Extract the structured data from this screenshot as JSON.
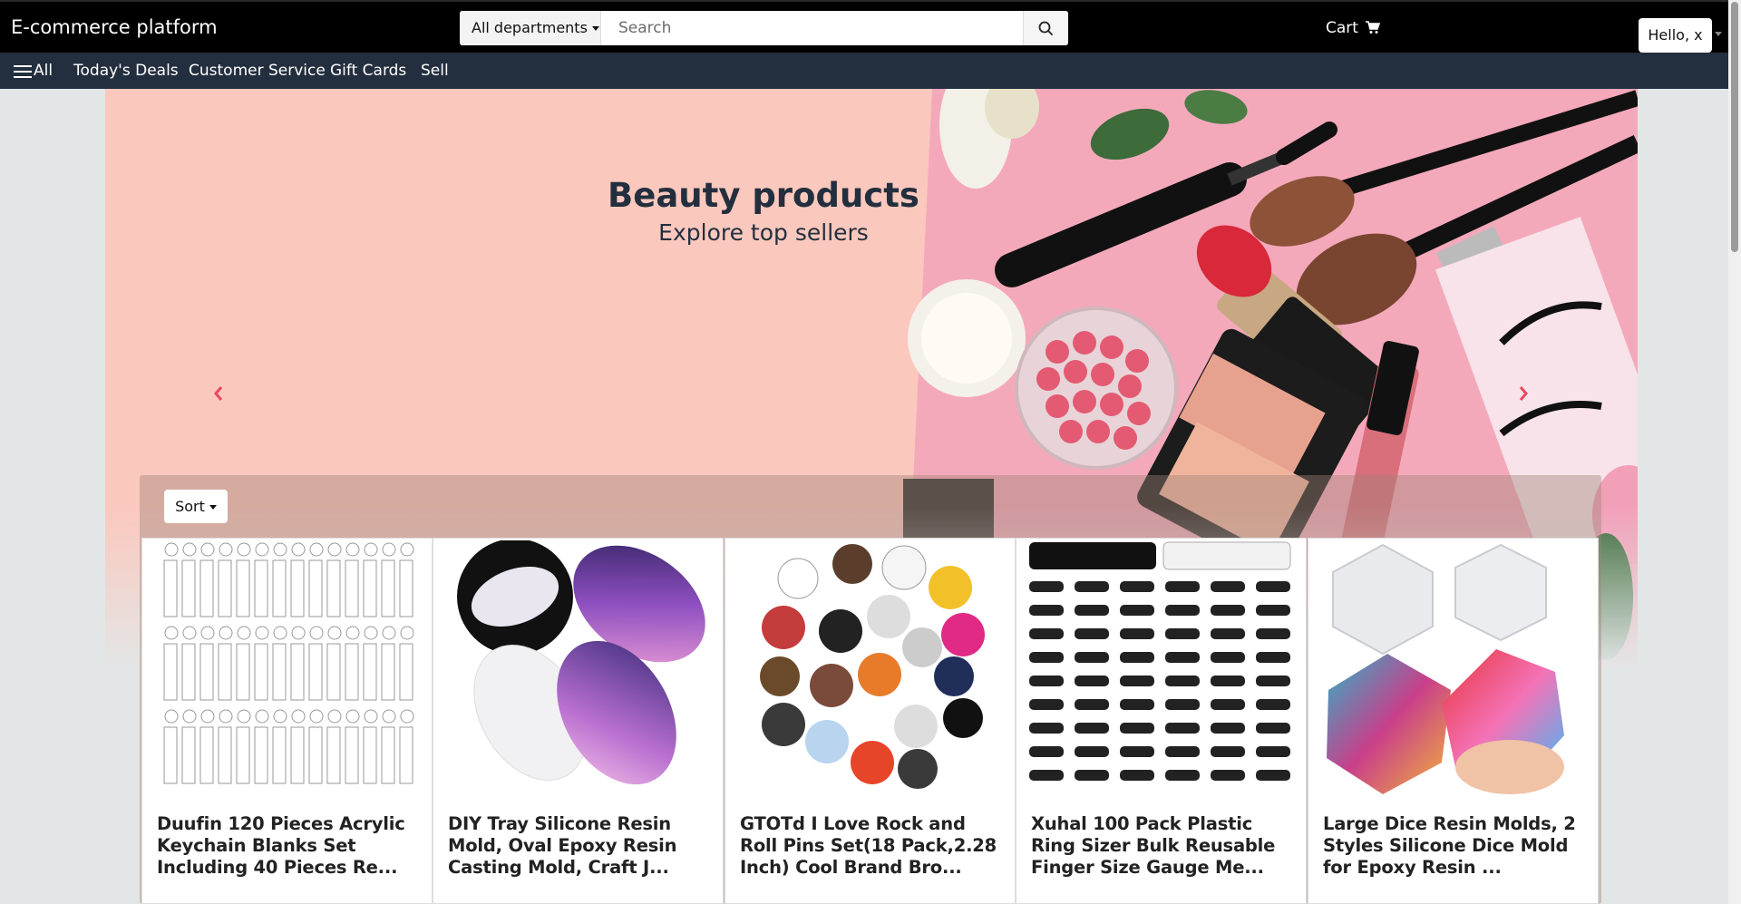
{
  "header": {
    "brand": "E-commerce platform",
    "department_label": "All departments",
    "search_placeholder": "Search",
    "search_value": "",
    "cart_label": "Cart",
    "greeting": "Hello, x"
  },
  "subnav": {
    "all_label": "All",
    "items": [
      "Today's Deals",
      "Customer Service",
      "Gift Cards",
      "Sell"
    ]
  },
  "hero": {
    "title": "Beauty products",
    "subtitle": "Explore top sellers"
  },
  "sort_label": "Sort",
  "products": [
    {
      "name": "Duufin 120 Pieces Acrylic Keychain Blanks Set Including 40 Pieces Re..."
    },
    {
      "name": "DIY Tray Silicone Resin Mold, Oval Epoxy Resin Casting Mold, Craft J..."
    },
    {
      "name": "GTOTd I Love Rock and Roll Pins Set(18 Pack,2.28 Inch)  Cool Brand Bro..."
    },
    {
      "name": "Xuhal 100 Pack Plastic Ring Sizer Bulk Reusable Finger Size Gauge Me..."
    },
    {
      "name": "Large Dice Resin Molds, 2 Styles Silicone Dice Mold for Epoxy Resin ..."
    }
  ],
  "icons": {
    "search": "search-icon",
    "cart": "cart-icon",
    "menu": "hamburger-icon",
    "prev": "chevron-left-icon",
    "next": "chevron-right-icon"
  },
  "colors": {
    "topbar": "#000000",
    "subnav": "#232f3e",
    "hero_bg": "#fbc8bd",
    "arrow": "#e8485f"
  }
}
